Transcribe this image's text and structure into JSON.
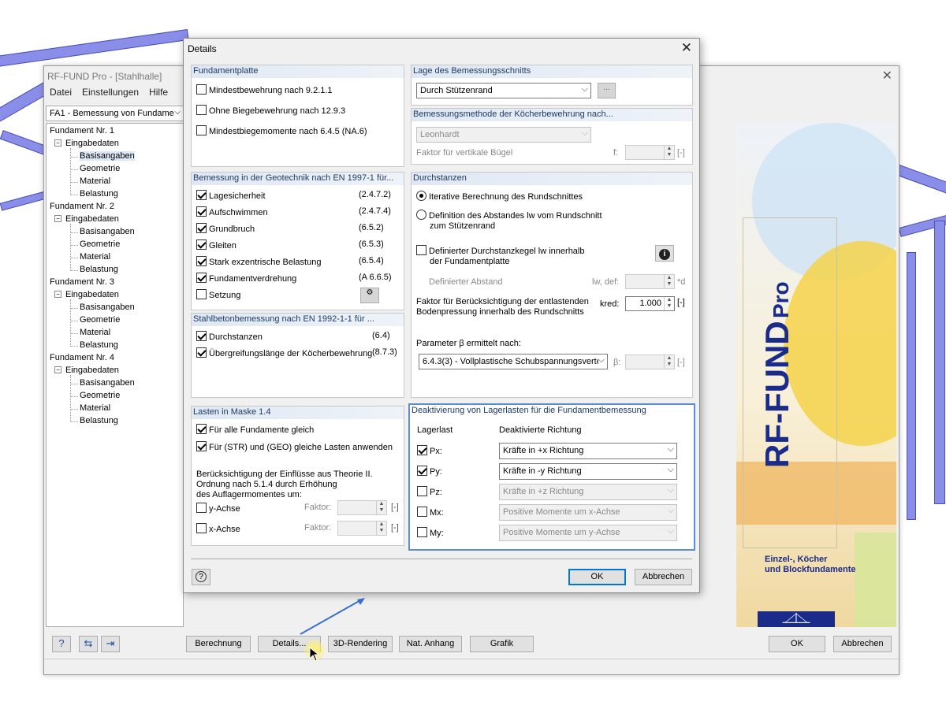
{
  "main": {
    "title": "RF-FUND Pro - [Stahlhalle]",
    "menu": [
      "Datei",
      "Einstellungen",
      "Hilfe"
    ],
    "case_select": "FA1 - Bemessung von Fundame",
    "tree": [
      {
        "label": "Fundament Nr. 1",
        "group": "Eingabedaten",
        "items": [
          "Basisangaben",
          "Geometrie",
          "Material",
          "Belastung"
        ]
      },
      {
        "label": "Fundament Nr. 2",
        "group": "Eingabedaten",
        "items": [
          "Basisangaben",
          "Geometrie",
          "Material",
          "Belastung"
        ]
      },
      {
        "label": "Fundament Nr. 3",
        "group": "Eingabedaten",
        "items": [
          "Basisangaben",
          "Geometrie",
          "Material",
          "Belastung"
        ]
      },
      {
        "label": "Fundament Nr. 4",
        "group": "Eingabedaten",
        "items": [
          "Basisangaben",
          "Geometrie",
          "Material",
          "Belastung"
        ]
      }
    ],
    "buttons": {
      "berechnung": "Berechnung",
      "details": "Details...",
      "rendering": "3D-Rendering",
      "anhang": "Nat. Anhang",
      "grafik": "Grafik",
      "ok": "OK",
      "abbrechen": "Abbrechen"
    },
    "product": {
      "name": "RF-FUND",
      "suffix": "Pro",
      "subtitle1": "Einzel-, Köcher",
      "subtitle2": "und Blockfundamente"
    }
  },
  "dialog": {
    "title": "Details",
    "fundamentplatte": {
      "header": "Fundamentplatte",
      "items": [
        {
          "label": "Mindestbewehrung nach 9.2.1.1",
          "checked": false
        },
        {
          "label": "Ohne Biegebewehrung nach 12.9.3",
          "checked": false
        },
        {
          "label": "Mindestbiegemomente nach 6.4.5 (NA.6)",
          "checked": false
        }
      ]
    },
    "geotechnik": {
      "header": "Bemessung in der Geotechnik nach EN 1997-1 für...",
      "items": [
        {
          "label": "Lagesicherheit",
          "ref": "(2.4.7.2)",
          "checked": true
        },
        {
          "label": "Aufschwimmen",
          "ref": "(2.4.7.4)",
          "checked": true
        },
        {
          "label": "Grundbruch",
          "ref": "(6.5.2)",
          "checked": true
        },
        {
          "label": "Gleiten",
          "ref": "(6.5.3)",
          "checked": true
        },
        {
          "label": "Stark exzentrische Belastung",
          "ref": "(6.5.4)",
          "checked": true
        },
        {
          "label": "Fundamentverdrehung",
          "ref": "(A 6.6.5)",
          "checked": true
        },
        {
          "label": "Setzung",
          "ref": "",
          "checked": false
        }
      ]
    },
    "stahlbeton": {
      "header": "Stahlbetonbemessung nach EN 1992-1-1 für ...",
      "items": [
        {
          "label": "Durchstanzen",
          "ref": "(6.4)",
          "checked": true
        },
        {
          "label": "Übergreifungslänge der Köcherbewehrung",
          "ref": "(8.7.3)",
          "checked": true
        }
      ]
    },
    "lasten": {
      "header": "Lasten in Maske 1.4",
      "items": [
        {
          "label": "Für alle Fundamente gleich",
          "checked": true
        },
        {
          "label": "Für (STR) und (GEO) gleiche Lasten anwenden",
          "checked": true
        }
      ],
      "note1": "Berücksichtigung der Einflüsse aus Theorie II.",
      "note2": "Ordnung nach 5.1.4 durch Erhöhung",
      "note3": "des Auflagermomentes um:",
      "axes": [
        {
          "label": "y-Achse",
          "checked": false,
          "factor_label": "Faktor:",
          "unit": "[-]"
        },
        {
          "label": "x-Achse",
          "checked": false,
          "factor_label": "Faktor:",
          "unit": "[-]"
        }
      ]
    },
    "lage": {
      "header": "Lage des Bemessungsschnitts",
      "value": "Durch Stützenrand",
      "btn": "..."
    },
    "koecher": {
      "header": "Bemessungsmethode der Köcherbewehrung nach...",
      "value": "Leonhardt",
      "faktor_label": "Faktor für vertikale Bügel",
      "f_label": "f:",
      "unit": "[-]"
    },
    "durchstanzen": {
      "header": "Durchstanzen",
      "radio1": "Iterative Berechnung des Rundschnittes",
      "radio2a": "Definition des Abstandes lw vom Rundschnitt",
      "radio2b": "zum Stützenrand",
      "cb_a": "Definierter Durchstanzkegel lw innerhalb",
      "cb_b": "der Fundamentplatte",
      "abstand_label": "Definierter Abstand",
      "abstand_sym": "lw, def:",
      "abstand_unit": "*d",
      "faktor_a": "Faktor für Berücksichtigung der entlastenden",
      "faktor_b": "Bodenpressung innerhalb des Rundschnitts",
      "kred_label": "kred:",
      "kred_value": "1.000",
      "kred_unit": "[-]",
      "param_label": "Parameter β ermittelt nach:",
      "param_value": "6.4.3(3) - Vollplastische Schubspannungsverte",
      "beta_label": "β:",
      "beta_unit": "[-]"
    },
    "deakt": {
      "header": "Deaktivierung von Lagerlasten für die Fundamentbemessung",
      "col1": "Lagerlast",
      "col2": "Deaktivierte Richtung",
      "rows": [
        {
          "label": "Px:",
          "checked": true,
          "value": "Kräfte in +x Richtung",
          "enabled": true
        },
        {
          "label": "Py:",
          "checked": true,
          "value": "Kräfte in -y Richtung",
          "enabled": true
        },
        {
          "label": "Pz:",
          "checked": false,
          "value": "Kräfte in +z Richtung",
          "enabled": false
        },
        {
          "label": "Mx:",
          "checked": false,
          "value": "Positive Momente um x-Achse",
          "enabled": false
        },
        {
          "label": "My:",
          "checked": false,
          "value": "Positive Momente um y-Achse",
          "enabled": false
        }
      ]
    },
    "ok": "OK",
    "abbrechen": "Abbrechen"
  }
}
